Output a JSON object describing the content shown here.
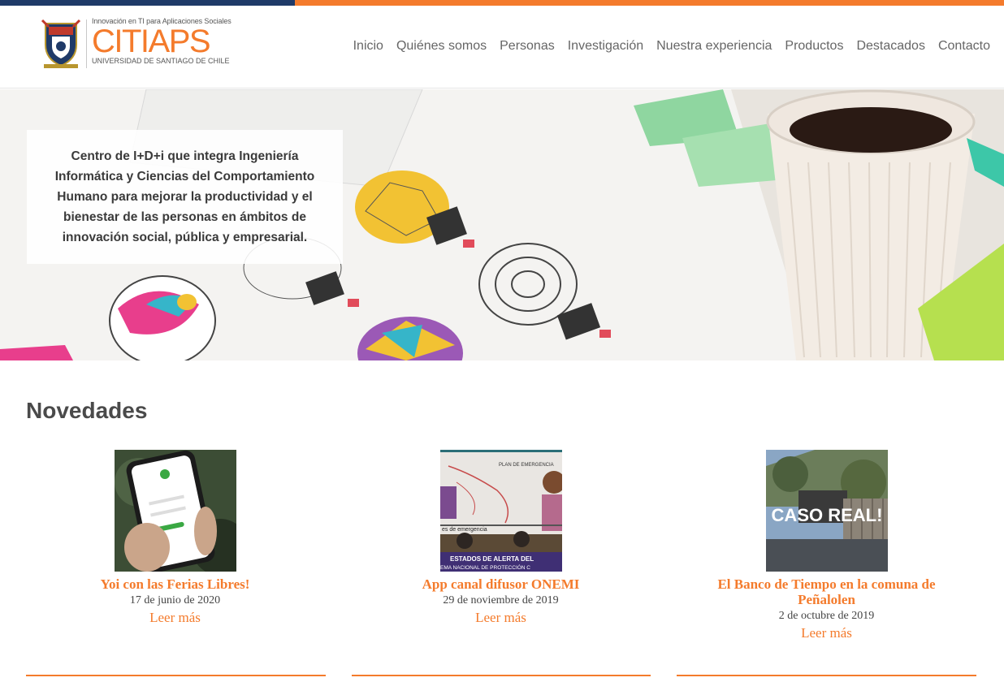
{
  "brand": {
    "tagline": "Innovación en TI para Aplicaciones Sociales",
    "name": "CITIAPS",
    "university": "UNIVERSIDAD DE SANTIAGO DE CHILE"
  },
  "nav": {
    "items": [
      "Inicio",
      "Quiénes somos",
      "Personas",
      "Investigación",
      "Nuestra experiencia",
      "Productos",
      "Destacados",
      "Contacto"
    ]
  },
  "hero": {
    "text": "Centro de I+D+i que integra Ingeniería Informática y Ciencias del Comportamiento Humano para mejorar la productividad y el bienestar de las personas en ámbitos de innovación social, pública y empresarial."
  },
  "novedades": {
    "title": "Novedades",
    "items": [
      {
        "title": "Yoi con las Ferias Libres!",
        "date": "17 de junio de 2020",
        "more": "Leer más"
      },
      {
        "title": "App canal difusor ONEMI",
        "date": "29 de noviembre de 2019",
        "more": "Leer más",
        "thumb_text_top": "PLAN DE EMERGENCIA",
        "thumb_text_mid": "es de emergencia",
        "thumb_text_bottom1": "ESTADOS DE ALERTA DEL",
        "thumb_text_bottom2": "EMA NACIONAL DE PROTECCIÓN C"
      },
      {
        "title": "El Banco de Tiempo en la comuna de Peñalolen",
        "date": "2 de octubre de 2019",
        "more": "Leer más",
        "thumb_text": "CASO REAL!"
      }
    ]
  },
  "colors": {
    "accent": "#f47b2c",
    "navy": "#1f3a68"
  }
}
